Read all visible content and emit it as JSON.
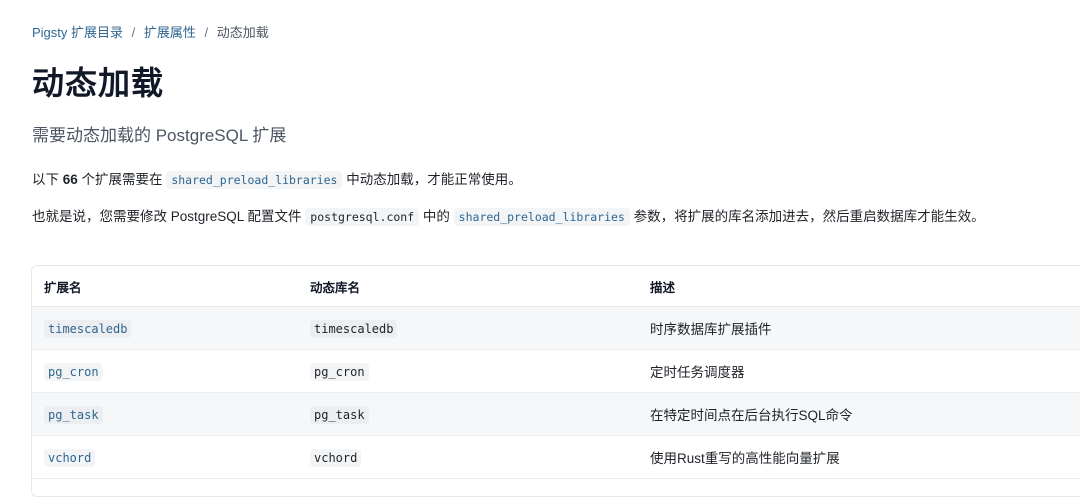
{
  "breadcrumb": {
    "root": "Pigsty 扩展目录",
    "parent": "扩展属性",
    "current": "动态加载",
    "separator": "/"
  },
  "title": "动态加载",
  "subtitle": "需要动态加载的 PostgreSQL 扩展",
  "intro": {
    "prefix": "以下 ",
    "count": "66",
    "middle": " 个扩展需要在 ",
    "code": "shared_preload_libraries",
    "suffix": " 中动态加载，才能正常使用。"
  },
  "detail": {
    "part1": "也就是说，您需要修改 PostgreSQL 配置文件 ",
    "code1": "postgresql.conf",
    "part2": " 中的 ",
    "code2": "shared_preload_libraries",
    "part3": " 参数，将扩展的库名添加进去，然后重启数据库才能生效。"
  },
  "table": {
    "headers": [
      "扩展名",
      "动态库名",
      "描述"
    ],
    "rows": [
      {
        "ext": "timescaledb",
        "lib": "timescaledb",
        "desc": "时序数据库扩展插件"
      },
      {
        "ext": "pg_cron",
        "lib": "pg_cron",
        "desc": "定时任务调度器"
      },
      {
        "ext": "pg_task",
        "lib": "pg_task",
        "desc": "在特定时间点在后台执行SQL命令"
      },
      {
        "ext": "vchord",
        "lib": "vchord",
        "desc": "使用Rust重写的高性能向量扩展"
      }
    ]
  }
}
